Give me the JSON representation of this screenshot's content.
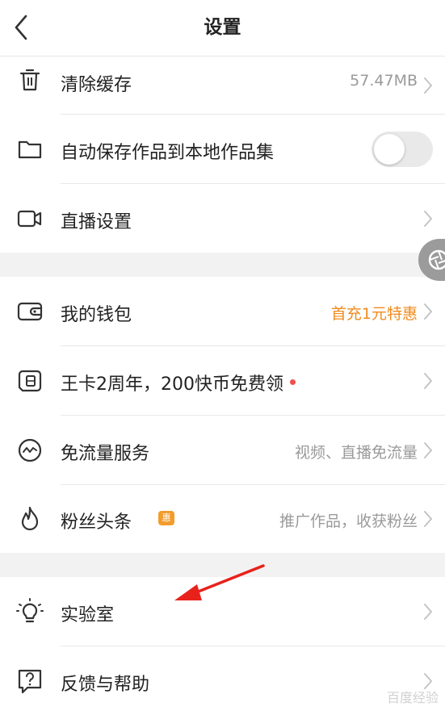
{
  "header": {
    "title": "设置"
  },
  "rows": {
    "clear_cache": {
      "label": "清除缓存",
      "value": "57.47MB"
    },
    "auto_save": {
      "label": "自动保存作品到本地作品集",
      "toggle_on": false
    },
    "live_settings": {
      "label": "直播设置"
    },
    "wallet": {
      "label": "我的钱包",
      "value": "首充1元特惠"
    },
    "wangka": {
      "label": "王卡2周年，200快币免费领"
    },
    "free_traffic": {
      "label": "免流量服务",
      "value": "视频、直播免流量"
    },
    "fans_headline": {
      "label": "粉丝头条",
      "badge": "惠",
      "value": "推广作品，收获粉丝"
    },
    "lab": {
      "label": "实验室"
    },
    "feedback": {
      "label": "反馈与帮助"
    }
  },
  "watermark": "百度经验",
  "colors": {
    "accent_orange": "#f08b1e",
    "red_dot": "#f0504a",
    "arrow": "#e8221b"
  }
}
